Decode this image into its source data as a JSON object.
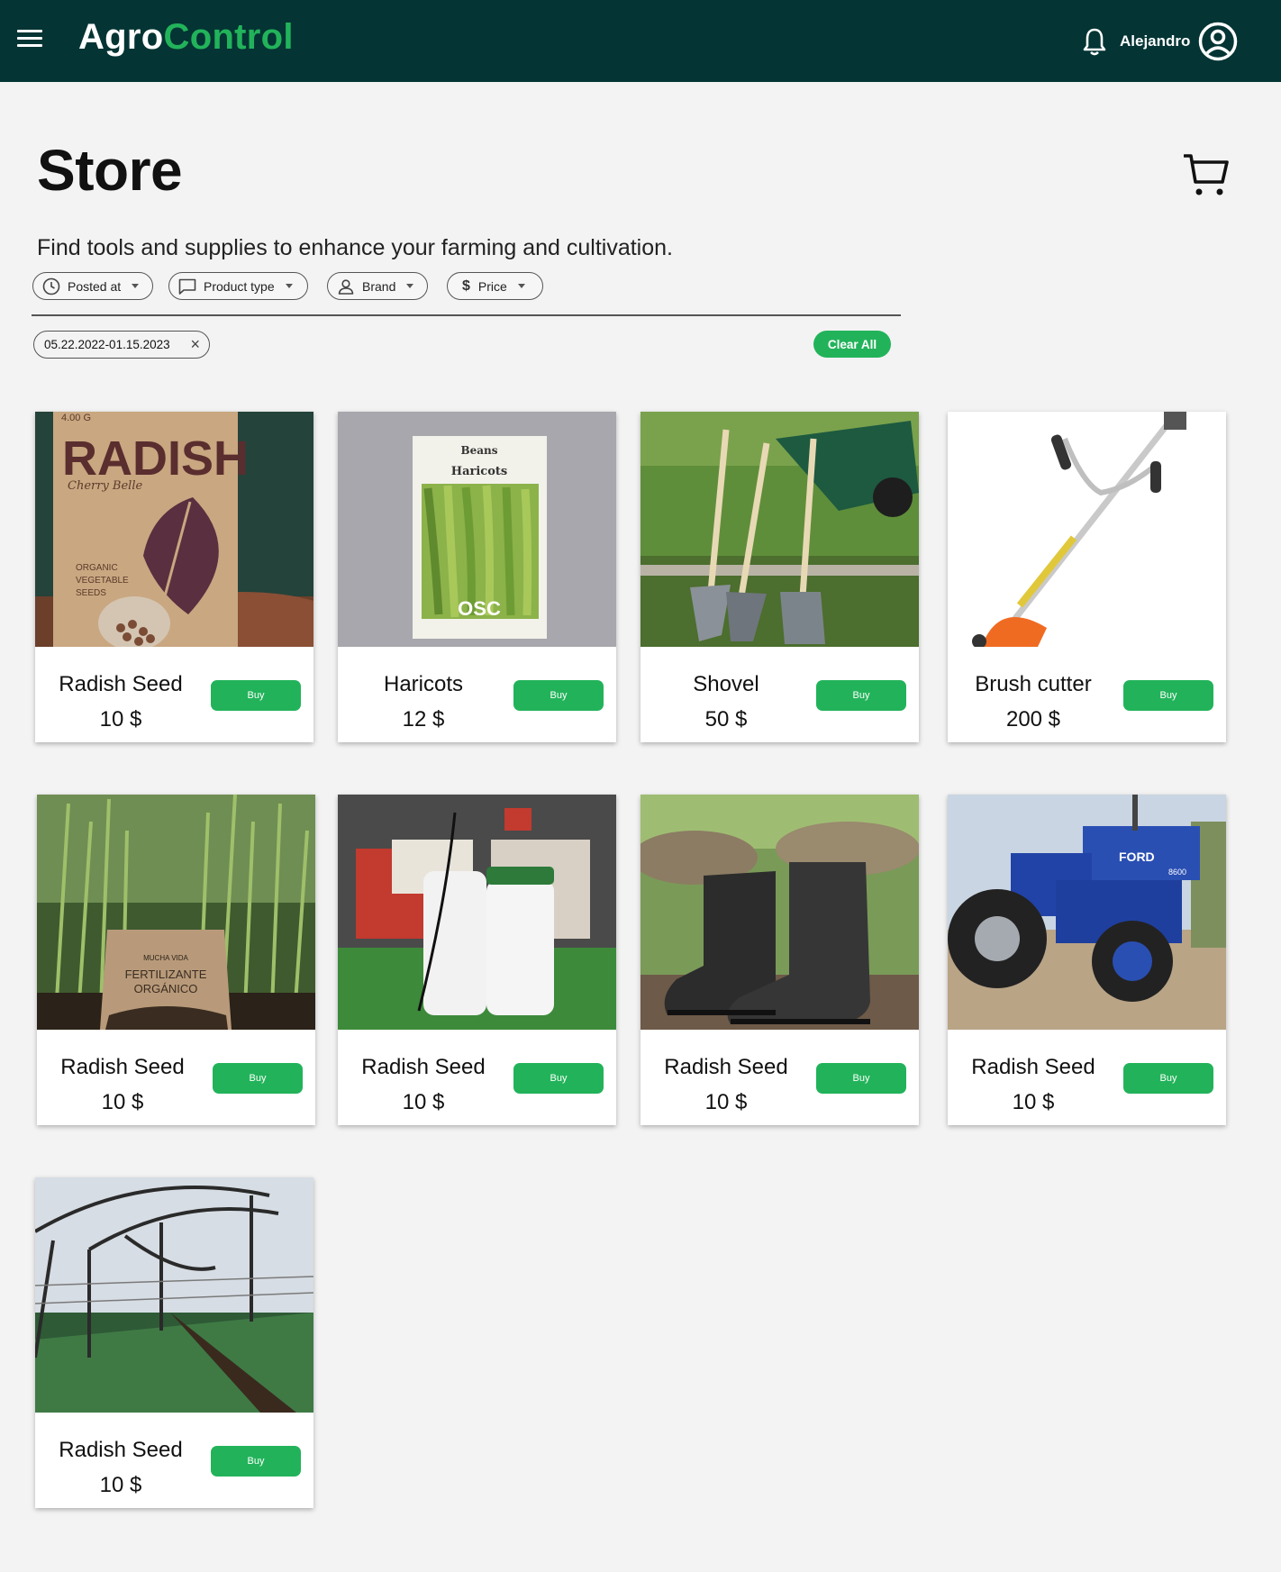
{
  "header": {
    "logo_part1": "Agro",
    "logo_part2": "Control",
    "username": "Alejandro"
  },
  "page": {
    "title": "Store",
    "subtitle": "Find tools and supplies to enhance your farming and cultivation."
  },
  "filters": [
    {
      "label": "Posted at",
      "icon": "clock-icon"
    },
    {
      "label": "Product type",
      "icon": "message-icon"
    },
    {
      "label": "Brand",
      "icon": "person-icon"
    },
    {
      "label": "Price",
      "icon": "dollar-icon"
    }
  ],
  "active_filter": {
    "label": "05.22.2022-01.15.2023"
  },
  "clear_all_label": "Clear All",
  "colors": {
    "topbar": "#043434",
    "accent": "#22b35a",
    "background": "#f3f3f3"
  },
  "products": [
    {
      "name": "Radish Seed",
      "price": "10 $",
      "buy_label": "Buy",
      "image": "radish-seed-packet-image",
      "image_text": {
        "weight": "4.00 G",
        "title": "RADISH",
        "variety": "Cherry Belle",
        "line1": "ORGANIC",
        "line2": "VEGETABLE",
        "line3": "SEEDS"
      }
    },
    {
      "name": "Haricots",
      "price": "12 $",
      "buy_label": "Buy",
      "image": "beans-seed-packet-image",
      "image_text": {
        "title1": "Beans",
        "title2": "Haricots",
        "brand": "OSC"
      }
    },
    {
      "name": "Shovel",
      "price": "50 $",
      "buy_label": "Buy",
      "image": "shovels-wheelbarrow-image"
    },
    {
      "name": "Brush cutter",
      "price": "200 $",
      "buy_label": "Buy",
      "image": "brush-cutter-image"
    },
    {
      "name": "Radish Seed",
      "price": "10 $",
      "buy_label": "Buy",
      "image": "fertilizer-bag-image",
      "image_text": {
        "brand": "MUCHA VIDA",
        "line1": "FERTILIZANTE",
        "line2": "ORGÁNICO"
      }
    },
    {
      "name": "Radish Seed",
      "price": "10 $",
      "buy_label": "Buy",
      "image": "sprayer-image"
    },
    {
      "name": "Radish Seed",
      "price": "10 $",
      "buy_label": "Buy",
      "image": "rubber-boots-image"
    },
    {
      "name": "Radish Seed",
      "price": "10 $",
      "buy_label": "Buy",
      "image": "blue-tractor-image",
      "image_text": {
        "brand": "FORD",
        "model": "8600"
      }
    },
    {
      "name": "Radish Seed",
      "price": "10 $",
      "buy_label": "Buy",
      "image": "greenhouse-image"
    }
  ]
}
